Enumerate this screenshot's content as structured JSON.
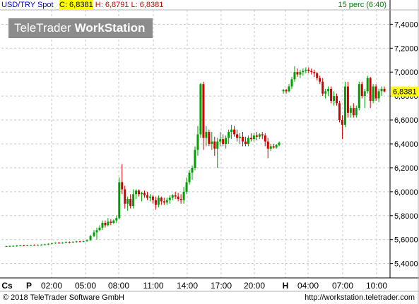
{
  "header": {
    "symbol": "USD/TRY Spot",
    "close_label": "C: 6,8381",
    "high_label": "H: 6,8791",
    "low_label": "L: 6,8381",
    "interval": "15 perc (6:40)"
  },
  "logo": {
    "part1": "TeleTrader",
    "part2": "WorkStation"
  },
  "footer": {
    "copyright": "© 2018 TeleTrader Software GmbH",
    "url": "http://workstation.teletrader.com"
  },
  "colors": {
    "up": "#00a000",
    "down": "#d40000",
    "last_price_bg": "#ffff00",
    "grid": "#c8c8c8"
  },
  "chart_data": {
    "type": "candlestick",
    "y_ticks": [
      "7,4000",
      "7,2000",
      "7,0000",
      "6,8000",
      "6,6000",
      "6,4000",
      "6,2000",
      "6,0000",
      "5,8000",
      "5,6000",
      "5,4000"
    ],
    "y_range": [
      5.28,
      7.52
    ],
    "last_price": "6,8381",
    "x_ticks": [
      "Cs",
      "P",
      "02:00",
      "05:00",
      "08:00",
      "11:00",
      "14:00",
      "17:00",
      "20:00",
      "H",
      "04:00",
      "07:00",
      "10:00"
    ],
    "x_max": 548,
    "ohlc": [
      [
        7,
        5.545,
        5.55,
        5.54,
        5.545
      ],
      [
        12,
        5.545,
        5.55,
        5.54,
        5.547
      ],
      [
        17,
        5.547,
        5.552,
        5.54,
        5.548
      ],
      [
        22,
        5.548,
        5.555,
        5.54,
        5.55
      ],
      [
        27,
        5.55,
        5.555,
        5.545,
        5.552
      ],
      [
        32,
        5.552,
        5.557,
        5.545,
        5.55
      ],
      [
        37,
        5.55,
        5.556,
        5.545,
        5.553
      ],
      [
        42,
        5.553,
        5.558,
        5.548,
        5.555
      ],
      [
        47,
        5.555,
        5.56,
        5.55,
        5.553
      ],
      [
        52,
        5.553,
        5.56,
        5.548,
        5.556
      ],
      [
        57,
        5.556,
        5.562,
        5.55,
        5.558
      ],
      [
        62,
        5.558,
        5.565,
        5.553,
        5.56
      ],
      [
        67,
        5.56,
        5.568,
        5.555,
        5.565
      ],
      [
        72,
        5.565,
        5.575,
        5.56,
        5.57
      ],
      [
        77,
        5.57,
        5.578,
        5.565,
        5.575
      ],
      [
        82,
        5.575,
        5.58,
        5.565,
        5.57
      ],
      [
        87,
        5.57,
        5.58,
        5.565,
        5.575
      ],
      [
        92,
        5.575,
        5.585,
        5.57,
        5.58
      ],
      [
        97,
        5.58,
        5.585,
        5.57,
        5.577
      ],
      [
        102,
        5.577,
        5.585,
        5.572,
        5.582
      ],
      [
        107,
        5.582,
        5.59,
        5.575,
        5.585
      ],
      [
        112,
        5.585,
        5.59,
        5.578,
        5.582
      ],
      [
        117,
        5.582,
        5.59,
        5.578,
        5.587
      ],
      [
        122,
        5.587,
        5.6,
        5.58,
        5.595
      ],
      [
        127,
        5.595,
        5.64,
        5.59,
        5.63
      ],
      [
        132,
        5.63,
        5.68,
        5.62,
        5.66
      ],
      [
        136,
        5.66,
        5.7,
        5.6,
        5.68
      ],
      [
        140,
        5.68,
        5.72,
        5.67,
        5.7
      ],
      [
        144,
        5.7,
        5.76,
        5.68,
        5.74
      ],
      [
        148,
        5.74,
        5.76,
        5.7,
        5.72
      ],
      [
        152,
        5.72,
        5.78,
        5.71,
        5.75
      ],
      [
        156,
        5.75,
        5.77,
        5.72,
        5.74
      ],
      [
        160,
        5.74,
        5.77,
        5.73,
        5.76
      ],
      [
        164,
        5.76,
        5.8,
        5.74,
        5.78
      ],
      [
        168,
        5.78,
        6.12,
        5.77,
        6.08
      ],
      [
        172,
        6.08,
        6.23,
        5.98,
        6.02
      ],
      [
        176,
        6.02,
        6.05,
        5.86,
        5.9
      ],
      [
        180,
        5.9,
        5.96,
        5.84,
        5.94
      ],
      [
        184,
        5.94,
        5.98,
        5.86,
        5.88
      ],
      [
        188,
        5.88,
        6.02,
        5.86,
        5.98
      ],
      [
        192,
        5.98,
        6.02,
        5.94,
        6.01
      ],
      [
        196,
        6.01,
        6.02,
        5.96,
        5.98
      ],
      [
        200,
        5.98,
        6.0,
        5.92,
        5.99
      ],
      [
        204,
        5.99,
        6.01,
        5.95,
        5.97
      ],
      [
        208,
        5.97,
        6.0,
        5.93,
        5.95
      ],
      [
        212,
        5.95,
        5.98,
        5.92,
        5.96
      ],
      [
        216,
        5.96,
        5.97,
        5.9,
        5.93
      ],
      [
        220,
        5.93,
        5.96,
        5.85,
        5.89
      ],
      [
        224,
        5.89,
        5.97,
        5.87,
        5.95
      ],
      [
        228,
        5.95,
        5.96,
        5.89,
        5.92
      ],
      [
        232,
        5.92,
        5.95,
        5.89,
        5.91
      ],
      [
        236,
        5.91,
        5.95,
        5.89,
        5.93
      ],
      [
        240,
        5.93,
        5.97,
        5.9,
        5.95
      ],
      [
        244,
        5.95,
        5.98,
        5.93,
        5.97
      ],
      [
        248,
        5.97,
        6.0,
        5.94,
        5.96
      ],
      [
        252,
        5.96,
        5.99,
        5.92,
        5.94
      ],
      [
        256,
        5.94,
        5.98,
        5.9,
        5.93
      ],
      [
        260,
        5.93,
        6.04,
        5.9,
        6.0
      ],
      [
        264,
        6.0,
        6.12,
        5.98,
        6.08
      ],
      [
        268,
        6.08,
        6.18,
        6.06,
        6.16
      ],
      [
        272,
        6.16,
        6.22,
        6.1,
        6.2
      ],
      [
        276,
        6.2,
        6.38,
        6.18,
        6.35
      ],
      [
        280,
        6.35,
        6.55,
        6.3,
        6.48
      ],
      [
        284,
        6.48,
        6.91,
        6.45,
        6.9
      ],
      [
        288,
        6.9,
        6.92,
        6.35,
        6.45
      ],
      [
        292,
        6.45,
        6.55,
        6.38,
        6.5
      ],
      [
        296,
        6.5,
        6.52,
        6.38,
        6.4
      ],
      [
        300,
        6.4,
        6.5,
        6.35,
        6.42
      ],
      [
        304,
        6.42,
        6.46,
        6.3,
        6.36
      ],
      [
        308,
        6.36,
        6.45,
        6.2,
        6.42
      ],
      [
        312,
        6.42,
        6.5,
        6.38,
        6.44
      ],
      [
        316,
        6.44,
        6.48,
        6.38,
        6.4
      ],
      [
        320,
        6.4,
        6.47,
        6.36,
        6.45
      ],
      [
        324,
        6.45,
        6.52,
        6.4,
        6.5
      ],
      [
        328,
        6.5,
        6.56,
        6.44,
        6.52
      ],
      [
        332,
        6.52,
        6.55,
        6.46,
        6.48
      ],
      [
        336,
        6.48,
        6.52,
        6.42,
        6.45
      ],
      [
        340,
        6.45,
        6.49,
        6.4,
        6.46
      ],
      [
        344,
        6.46,
        6.5,
        6.38,
        6.42
      ],
      [
        348,
        6.42,
        6.46,
        6.38,
        6.4
      ],
      [
        352,
        6.4,
        6.47,
        6.38,
        6.45
      ],
      [
        356,
        6.45,
        6.49,
        6.42,
        6.44
      ],
      [
        360,
        6.44,
        6.49,
        6.42,
        6.47
      ],
      [
        364,
        6.47,
        6.5,
        6.43,
        6.46
      ],
      [
        368,
        6.46,
        6.49,
        6.44,
        6.48
      ],
      [
        372,
        6.48,
        6.5,
        6.44,
        6.47
      ],
      [
        376,
        6.47,
        6.49,
        6.38,
        6.42
      ],
      [
        380,
        6.42,
        6.45,
        6.28,
        6.36
      ],
      [
        384,
        6.36,
        6.4,
        6.34,
        6.38
      ],
      [
        388,
        6.38,
        6.4,
        6.36,
        6.37
      ],
      [
        392,
        6.37,
        6.4,
        6.36,
        6.39
      ],
      [
        396,
        6.39,
        6.42,
        6.38,
        6.41
      ],
      [
        402,
        6.84,
        6.86,
        6.82,
        6.85
      ],
      [
        406,
        6.85,
        6.86,
        6.82,
        6.84
      ],
      [
        410,
        6.84,
        6.9,
        6.83,
        6.88
      ],
      [
        414,
        6.88,
        6.96,
        6.86,
        6.94
      ],
      [
        418,
        6.94,
        7.05,
        6.92,
        7.0
      ],
      [
        422,
        7.0,
        7.03,
        6.96,
        6.98
      ],
      [
        426,
        6.98,
        7.02,
        6.95,
        7.0
      ],
      [
        430,
        7.0,
        7.03,
        6.97,
        7.01
      ],
      [
        434,
        7.01,
        7.04,
        6.99,
        7.02
      ],
      [
        438,
        7.02,
        7.04,
        6.99,
        7.01
      ],
      [
        442,
        7.01,
        7.03,
        6.98,
        7.0
      ],
      [
        446,
        7.0,
        7.02,
        6.96,
        6.99
      ],
      [
        450,
        6.99,
        7.0,
        6.93,
        6.95
      ],
      [
        454,
        6.95,
        6.97,
        6.9,
        6.92
      ],
      [
        458,
        6.92,
        6.95,
        6.8,
        6.82
      ],
      [
        462,
        6.82,
        6.86,
        6.78,
        6.84
      ],
      [
        466,
        6.84,
        6.88,
        6.8,
        6.86
      ],
      [
        470,
        6.86,
        6.88,
        6.74,
        6.76
      ],
      [
        474,
        6.76,
        6.84,
        6.72,
        6.8
      ],
      [
        478,
        6.8,
        6.82,
        6.72,
        6.74
      ],
      [
        482,
        6.74,
        6.76,
        6.58,
        6.6
      ],
      [
        486,
        6.6,
        6.64,
        6.44,
        6.56
      ],
      [
        490,
        6.56,
        6.92,
        6.54,
        6.88
      ],
      [
        494,
        6.88,
        6.92,
        6.62,
        6.66
      ],
      [
        498,
        6.66,
        6.72,
        6.62,
        6.7
      ],
      [
        502,
        6.7,
        6.74,
        6.62,
        6.64
      ],
      [
        506,
        6.64,
        6.72,
        6.62,
        6.7
      ],
      [
        510,
        6.7,
        6.92,
        6.68,
        6.9
      ],
      [
        514,
        6.9,
        6.92,
        6.78,
        6.8
      ],
      [
        518,
        6.8,
        6.86,
        6.7,
        6.84
      ],
      [
        522,
        6.84,
        6.97,
        6.82,
        6.95
      ],
      [
        526,
        6.95,
        6.96,
        6.7,
        6.76
      ],
      [
        530,
        6.76,
        6.9,
        6.74,
        6.88
      ],
      [
        534,
        6.88,
        6.9,
        6.76,
        6.78
      ],
      [
        538,
        6.78,
        6.86,
        6.75,
        6.84
      ],
      [
        542,
        6.84,
        6.88,
        6.8,
        6.86
      ],
      [
        546,
        6.86,
        6.88,
        6.83,
        6.838
      ]
    ]
  }
}
